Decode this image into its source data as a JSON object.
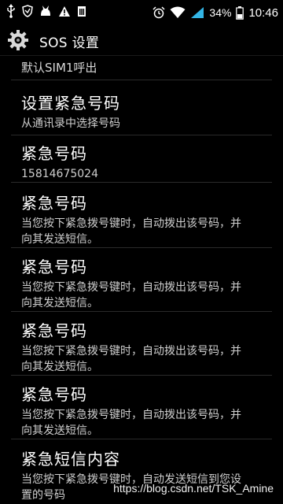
{
  "status_bar": {
    "left_icons": [
      "usb-icon",
      "shield-icon",
      "cat-icon",
      "warning-icon",
      "sim-icon"
    ],
    "right_icons": [
      "alarm-icon",
      "wifi-icon",
      "signal-icon",
      "battery-icon"
    ],
    "battery_percent": "34%",
    "time": "10:46"
  },
  "action_bar": {
    "icon": "gear-icon",
    "title": "SOS 设置"
  },
  "settings": {
    "partial_item": "默认SIM1呼出",
    "items": [
      {
        "title": "设置紧急号码",
        "summary": "从通讯录中选择号码"
      },
      {
        "title": "紧急号码",
        "summary": "15814675024"
      },
      {
        "title": "紧急号码",
        "summary": "当您按下紧急拨号键时，自动拨出该号码，并向其发送短信。"
      },
      {
        "title": "紧急号码",
        "summary": "当您按下紧急拨号键时，自动拨出该号码，并向其发送短信。"
      },
      {
        "title": "紧急号码",
        "summary": "当您按下紧急拨号键时，自动拨出该号码，并向其发送短信。"
      },
      {
        "title": "紧急号码",
        "summary": "当您按下紧急拨号键时，自动拨出该号码，并向其发送短信。"
      },
      {
        "title": "紧急短信内容",
        "summary": "当您按下紧急拨号键时，自动发送短信到您设置的号码"
      }
    ]
  },
  "watermark": "https://blog.csdn.net/TSK_Amine",
  "colors": {
    "background": "#000000",
    "wifi_signal": "#33b5e5",
    "signal_bars": "#33b5e5"
  }
}
